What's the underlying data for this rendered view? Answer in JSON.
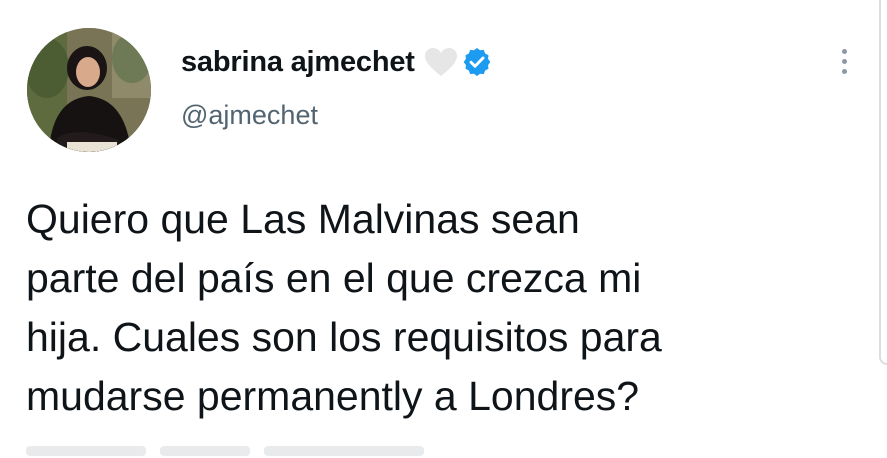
{
  "tweet": {
    "author": {
      "display_name": "sabrina ajmechet",
      "handle": "@ajmechet"
    },
    "text": "Quiero que Las Malvinas sean\nparte del país en el que crezca mi\nhija. Cuales son los requisitos para\nmudarse permanently a Londres?"
  },
  "icons": {
    "heart": "heart-icon",
    "verified": "verified-badge-icon",
    "more": "more-options-icon"
  },
  "colors": {
    "verified_blue": "#1d9bf0",
    "handle_gray": "#536471",
    "text": "#0f1419"
  }
}
